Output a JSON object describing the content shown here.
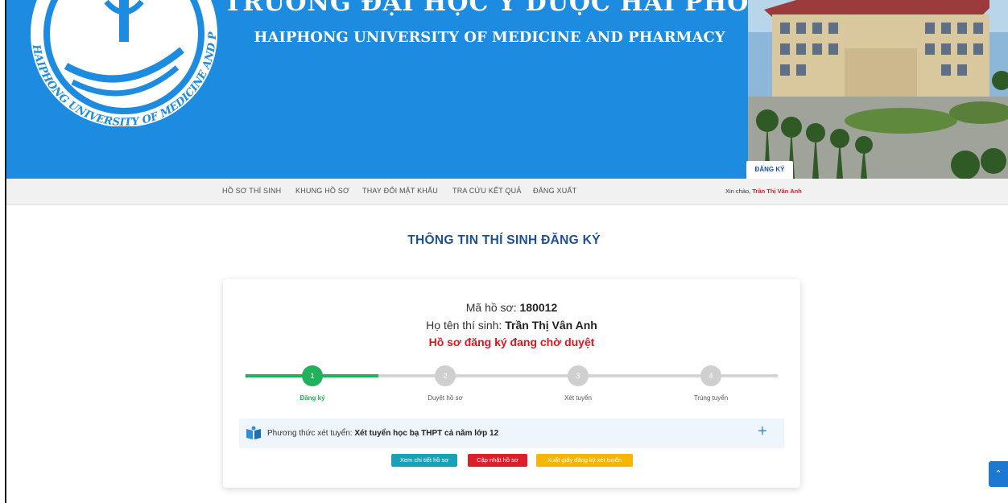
{
  "banner": {
    "title_vi": "TRƯỜNG ĐẠI HỌC Y DƯỢC HẢI PHÒNG",
    "title_en": "HAIPHONG UNIVERSITY OF MEDICINE AND PHARMACY",
    "logo_text": "HAIPHONG UNIVERSITY OF MEDICINE AND PHARMACY",
    "register_tab": "ĐĂNG KÝ"
  },
  "nav": {
    "items": [
      "HỒ SƠ THÍ SINH",
      "KHUNG HỒ SƠ",
      "THAY ĐỔI MẬT KHẨU",
      "TRA CỨU KẾT QUẢ",
      "ĐĂNG XUẤT"
    ],
    "greeting_prefix": "Xin chào,",
    "user_name": "Trần Thị Vân Anh"
  },
  "main": {
    "page_title": "THÔNG TIN THÍ SINH ĐĂNG KÝ",
    "profile_code_label": "Mã hồ sơ:",
    "profile_code": "180012",
    "candidate_name_label": "Họ tên thí sinh:",
    "candidate_name": "Trần Thị Vân Anh",
    "status": "Hồ sơ đăng ký đang chờ duyệt",
    "steps": [
      {
        "num": "1",
        "label": "Đăng ký",
        "active": true
      },
      {
        "num": "2",
        "label": "Duyệt hồ sơ",
        "active": false
      },
      {
        "num": "3",
        "label": "Xét tuyển",
        "active": false
      },
      {
        "num": "4",
        "label": "Trúng tuyển",
        "active": false
      }
    ],
    "method_label": "Phương thức xét tuyển:",
    "method_value": "Xét tuyển học bạ THPT cả năm lớp 12",
    "buttons": {
      "view": "Xem chi tiết hồ sơ",
      "update": "Cập nhật hồ sơ",
      "export": "Xuất giấy đăng ký xét tuyển"
    }
  },
  "icons": {
    "method": "book-icon",
    "expand": "plus-icon",
    "scroll": "chevron-up-icon"
  },
  "colors": {
    "banner_blue": "#1c8be0",
    "title_blue": "#1d4f91",
    "active_green": "#20b15a",
    "status_red": "#e0141e",
    "btn_view": "#17a2b8",
    "btn_update": "#dc1f2a",
    "btn_export": "#f5b500"
  }
}
